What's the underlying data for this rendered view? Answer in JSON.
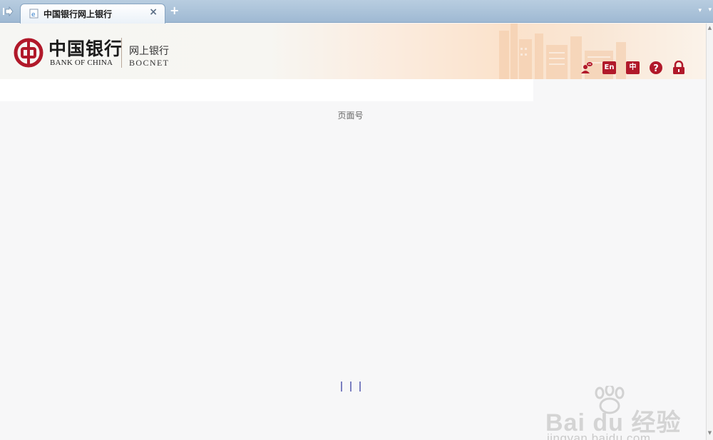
{
  "browser": {
    "tab_title": "中国银行网上银行",
    "close_symbol": "×",
    "new_tab_symbol": "+",
    "menu_symbol": "▾"
  },
  "header": {
    "logo_cn": "中国银行",
    "logo_en": "BANK OF CHINA",
    "brand_cn": "网上银行",
    "brand_en": "BOCNET",
    "tools": [
      {
        "icon": "customer-service-icon"
      },
      {
        "label": "En",
        "icon": "english-language-icon"
      },
      {
        "label": "中",
        "icon": "chinese-language-icon"
      },
      {
        "icon": "help-icon"
      },
      {
        "icon": "lock-icon"
      }
    ],
    "accent_color": "#b1192a"
  },
  "main": {
    "page_label": "页面号"
  },
  "watermark": {
    "brand": "Bai du 经验",
    "url": "jingyan.baidu.com"
  }
}
